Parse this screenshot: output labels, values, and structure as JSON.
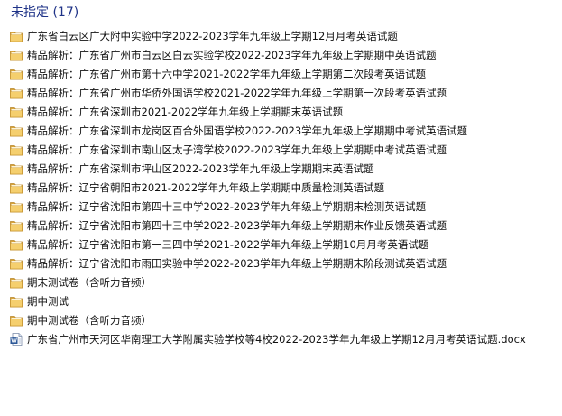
{
  "group": {
    "title": "未指定 (17)"
  },
  "items": [
    {
      "type": "folder",
      "name": "广东省白云区广大附中实验中学2022-2023学年九年级上学期12月月考英语试题"
    },
    {
      "type": "folder",
      "name": "精品解析：广东省广州市白云区白云实验学校2022-2023学年九年级上学期期中英语试题"
    },
    {
      "type": "folder",
      "name": "精品解析：广东省广州市第十六中学2021-2022学年九年级上学期第二次段考英语试题"
    },
    {
      "type": "folder",
      "name": "精品解析：广东省广州市华侨外国语学校2021-2022学年九年级上学期第一次段考英语试题"
    },
    {
      "type": "folder",
      "name": "精品解析：广东省深圳市2021-2022学年九年级上学期期末英语试题"
    },
    {
      "type": "folder",
      "name": "精品解析：广东省深圳市龙岗区百合外国语学校2022-2023学年九年级上学期期中考试英语试题"
    },
    {
      "type": "folder",
      "name": "精品解析：广东省深圳市南山区太子湾学校2022-2023学年九年级上学期期中考试英语试题"
    },
    {
      "type": "folder",
      "name": "精品解析：广东省深圳市坪山区2022-2023学年九年级上学期期末英语试题"
    },
    {
      "type": "folder",
      "name": "精品解析：辽宁省朝阳市2021-2022学年九年级上学期期中质量检测英语试题"
    },
    {
      "type": "folder",
      "name": "精品解析：辽宁省沈阳市第四十三中学2022-2023学年九年级上学期期末检测英语试题"
    },
    {
      "type": "folder",
      "name": "精品解析：辽宁省沈阳市第四十三中学2022-2023学年九年级上学期期末作业反馈英语试题"
    },
    {
      "type": "folder",
      "name": "精品解析：辽宁省沈阳市第一三四中学2021-2022学年九年级上学期10月月考英语试题"
    },
    {
      "type": "folder",
      "name": "精品解析：辽宁省沈阳市雨田实验中学2022-2023学年九年级上学期期末阶段测试英语试题"
    },
    {
      "type": "folder",
      "name": "期末测试卷（含听力音频）"
    },
    {
      "type": "folder",
      "name": "期中测试"
    },
    {
      "type": "folder",
      "name": "期中测试卷（含听力音频）"
    },
    {
      "type": "docx",
      "name": "广东省广州市天河区华南理工大学附属实验学校等4校2022-2023学年九年级上学期12月月考英语试题.docx"
    }
  ],
  "icons": {
    "folder": "folder-icon",
    "docx": "word-document-icon"
  },
  "colors": {
    "group_title": "#1e3287",
    "folder_body": "#e8b84a",
    "folder_front": "#f7d37a",
    "word_blue": "#2b5797"
  }
}
